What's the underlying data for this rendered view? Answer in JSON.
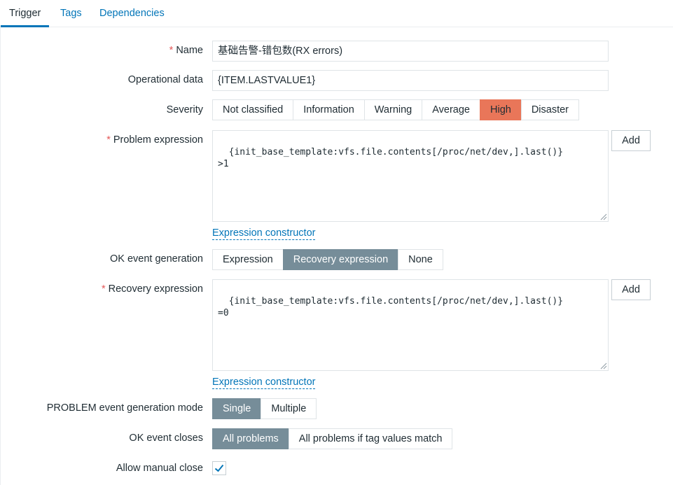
{
  "tabs": [
    {
      "label": "Trigger"
    },
    {
      "label": "Tags"
    },
    {
      "label": "Dependencies"
    }
  ],
  "form": {
    "name": {
      "label": "Name",
      "required_mark": "*",
      "value": "基础告警-错包数(RX errors)"
    },
    "operational_data": {
      "label": "Operational data",
      "value": "{ITEM.LASTVALUE1}"
    },
    "severity": {
      "label": "Severity",
      "options": [
        "Not classified",
        "Information",
        "Warning",
        "Average",
        "High",
        "Disaster"
      ],
      "selected": "High",
      "selected_color": "#e97659"
    },
    "problem_expression": {
      "label": "Problem expression",
      "required_mark": "*",
      "value": "{init_base_template:vfs.file.contents[/proc/net/dev,].last()}\n>1",
      "add_label": "Add",
      "constructor_link": "Expression constructor"
    },
    "ok_event_generation": {
      "label": "OK event generation",
      "options": [
        "Expression",
        "Recovery expression",
        "None"
      ],
      "selected": "Recovery expression"
    },
    "recovery_expression": {
      "label": "Recovery expression",
      "required_mark": "*",
      "value": "{init_base_template:vfs.file.contents[/proc/net/dev,].last()}\n=0",
      "add_label": "Add",
      "constructor_link": "Expression constructor"
    },
    "problem_mode": {
      "label": "PROBLEM event generation mode",
      "options": [
        "Single",
        "Multiple"
      ],
      "selected": "Single"
    },
    "ok_closes": {
      "label": "OK event closes",
      "options": [
        "All problems",
        "All problems if tag values match"
      ],
      "selected": "All problems"
    },
    "manual_close": {
      "label": "Allow manual close",
      "checked": true,
      "check_color": "#0275b8"
    }
  },
  "colors": {
    "accent": "#0275b8",
    "selected_segment": "#768d99",
    "required": "#e45959"
  }
}
